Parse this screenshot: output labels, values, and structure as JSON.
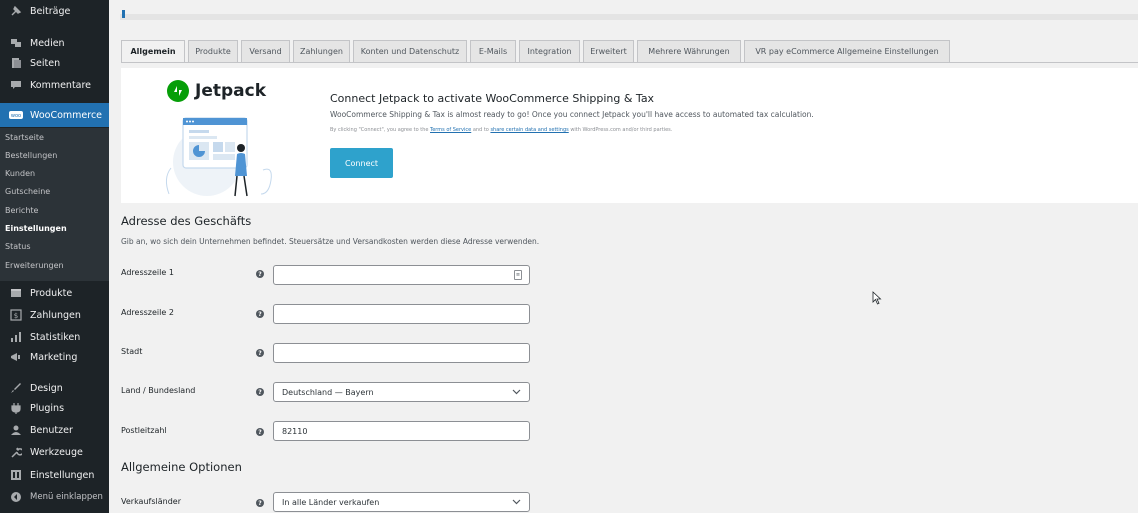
{
  "sidebar": {
    "items": [
      {
        "label": "Beiträge",
        "icon": "pin-icon"
      },
      {
        "label": "Medien",
        "icon": "media-icon"
      },
      {
        "label": "Seiten",
        "icon": "page-icon"
      },
      {
        "label": "Kommentare",
        "icon": "comment-icon"
      },
      {
        "label": "WooCommerce",
        "icon": "woo-icon"
      },
      {
        "label": "Produkte",
        "icon": "box-icon"
      },
      {
        "label": "Zahlungen",
        "icon": "payment-icon"
      },
      {
        "label": "Statistiken",
        "icon": "bar-chart-icon"
      },
      {
        "label": "Marketing",
        "icon": "megaphone-icon"
      },
      {
        "label": "Design",
        "icon": "brush-icon"
      },
      {
        "label": "Plugins",
        "icon": "plug-icon"
      },
      {
        "label": "Benutzer",
        "icon": "user-icon"
      },
      {
        "label": "Werkzeuge",
        "icon": "wrench-icon"
      },
      {
        "label": "Einstellungen",
        "icon": "settings-icon"
      },
      {
        "label": "Menü einklappen",
        "icon": "collapse-icon"
      }
    ],
    "submenu": [
      "Startseite",
      "Bestellungen",
      "Kunden",
      "Gutscheine",
      "Berichte",
      "Einstellungen",
      "Status",
      "Erweiterungen"
    ],
    "active_submenu": "Einstellungen",
    "current_item": "WooCommerce"
  },
  "tabs": [
    "Allgemein",
    "Produkte",
    "Versand",
    "Zahlungen",
    "Konten und Datenschutz",
    "E-Mails",
    "Integration",
    "Erweitert",
    "Mehrere Währungen",
    "VR pay eCommerce Allgemeine Einstellungen"
  ],
  "active_tab": "Allgemein",
  "jetpack": {
    "logo_text": "Jetpack",
    "title": "Connect Jetpack to activate WooCommerce Shipping & Tax",
    "description": "WooCommerce Shipping & Tax is almost ready to go! Once you connect Jetpack you'll have access to automated tax calculation.",
    "legal_prefix": "By clicking \"Connect\", you agree to the ",
    "legal_link1": "Terms of Service",
    "legal_middle": " and to ",
    "legal_link2": "share certain data and settings",
    "legal_suffix": " with WordPress.com and/or third parties.",
    "connect_label": "Connect"
  },
  "store_address": {
    "heading": "Adresse des Geschäfts",
    "description": "Gib an, wo sich dein Unternehmen befindet. Steuersätze und Versandkosten werden diese Adresse verwenden.",
    "fields": [
      {
        "label": "Adresszeile 1",
        "value": ""
      },
      {
        "label": "Adresszeile 2",
        "value": ""
      },
      {
        "label": "Stadt",
        "value": ""
      },
      {
        "label": "Land / Bundesland",
        "value": "Deutschland — Bayern"
      },
      {
        "label": "Postleitzahl",
        "value": "82110"
      }
    ]
  },
  "general_options": {
    "heading": "Allgemeine Optionen",
    "fields": [
      {
        "label": "Verkaufsländer",
        "value": "In alle Länder verkaufen"
      }
    ]
  },
  "colors": {
    "sidebar_bg": "#1d2327",
    "accent": "#2271b1",
    "connect_button": "#2ea2cc",
    "jetpack_green": "#069e08"
  }
}
